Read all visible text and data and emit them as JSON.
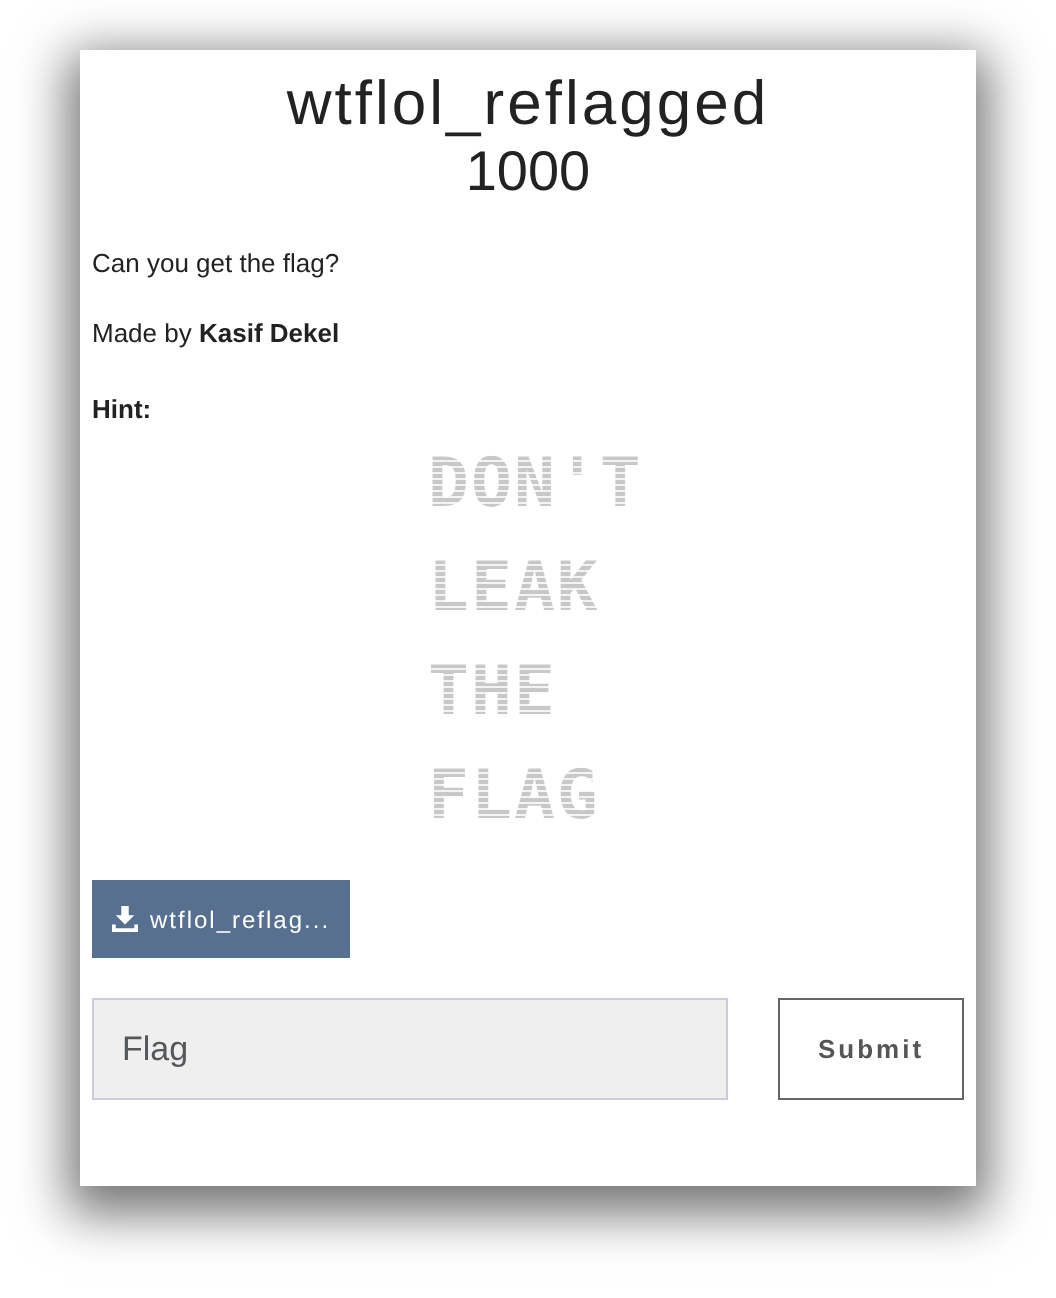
{
  "challenge": {
    "title": "wtflol_reflagged",
    "points": "1000"
  },
  "description": [
    "Can you get the flag?",
    "Made by **Kasif Dekel**"
  ],
  "hint": {
    "label": "Hint:",
    "lines": [
      "DON'T",
      "LEAK",
      "THE",
      "FLAG"
    ]
  },
  "file_button": {
    "label": "wtflol_reflag..."
  },
  "flag_field": {
    "placeholder": "Flag"
  },
  "submit_button": {
    "label": "Submit"
  }
}
